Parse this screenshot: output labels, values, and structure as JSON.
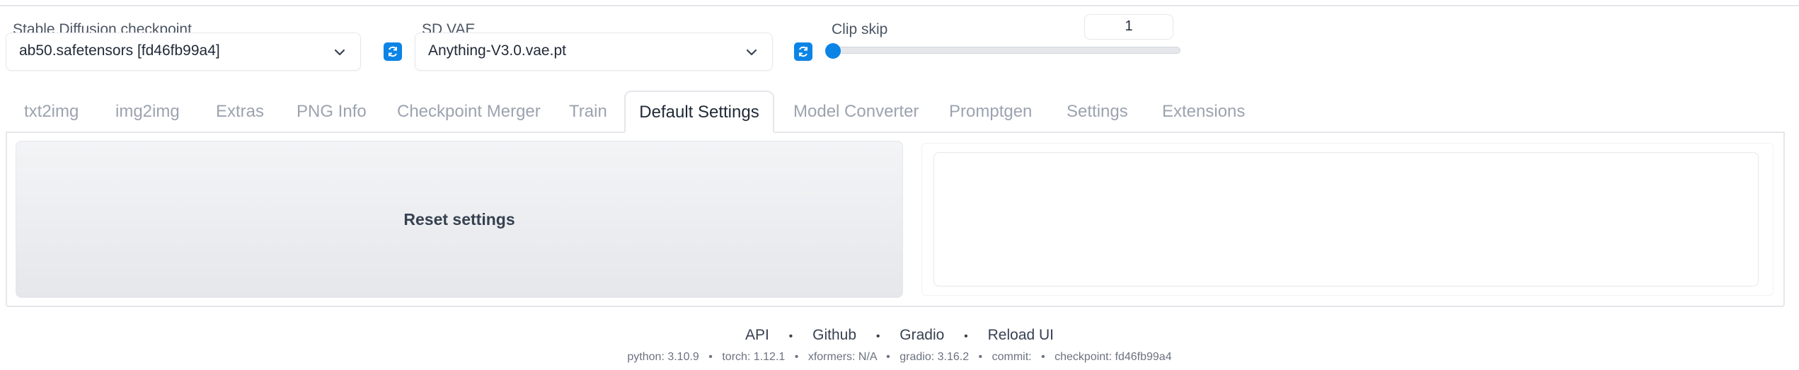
{
  "checkpoint": {
    "label": "Stable Diffusion checkpoint",
    "value": "ab50.safetensors [fd46fb99a4]"
  },
  "vae": {
    "label": "SD VAE",
    "value": "Anything-V3.0.vae.pt"
  },
  "clip_skip": {
    "label": "Clip skip",
    "value": "1",
    "level_fraction": 0.0
  },
  "tabs": [
    {
      "label": "txt2img"
    },
    {
      "label": "img2img"
    },
    {
      "label": "Extras"
    },
    {
      "label": "PNG Info"
    },
    {
      "label": "Checkpoint Merger"
    },
    {
      "label": "Train"
    },
    {
      "label": "Default Settings",
      "active": true
    },
    {
      "label": "Model Converter"
    },
    {
      "label": "Promptgen"
    },
    {
      "label": "Settings"
    },
    {
      "label": "Extensions"
    }
  ],
  "reset_button": "Reset settings",
  "footer": {
    "links": [
      "API",
      "Github",
      "Gradio",
      "Reload UI"
    ],
    "separator": "•",
    "info": [
      "python: 3.10.9",
      "torch: 1.12.1",
      "xformers: N/A",
      "gradio: 3.16.2",
      "commit:",
      "checkpoint: fd46fb99a4"
    ]
  },
  "colors": {
    "accent": "#0b84e6",
    "border": "#e5e7eb",
    "inactive_tab": "#9ca3af"
  },
  "icons": {
    "refresh": "refresh-icon",
    "chevron": "chevron-down-icon"
  }
}
